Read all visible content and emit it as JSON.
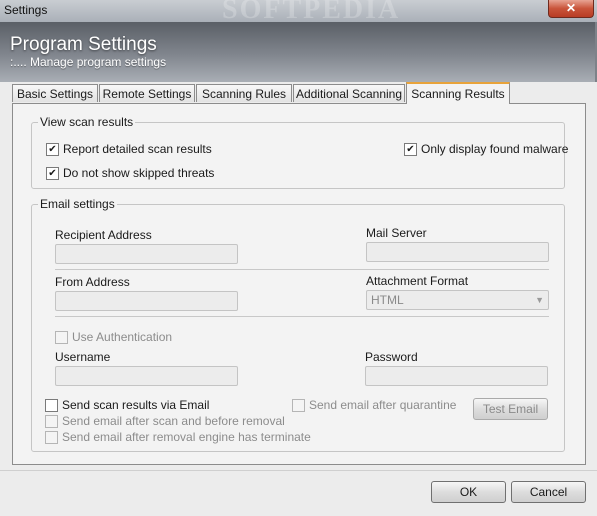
{
  "window": {
    "title": "Settings",
    "close_label": "✕",
    "watermark": "SOFTPEDIA"
  },
  "header": {
    "title": "Program Settings",
    "subtitle": ":.... Manage program settings"
  },
  "tabs": [
    {
      "label": "Basic Settings"
    },
    {
      "label": "Remote Settings"
    },
    {
      "label": "Scanning Rules"
    },
    {
      "label": "Additional Scanning"
    },
    {
      "label": "Scanning Results",
      "active": true
    }
  ],
  "view_scan_results": {
    "legend": "View scan results",
    "report_detailed": {
      "label": "Report detailed scan results",
      "checked": true
    },
    "do_not_show_skipped": {
      "label": "Do not show skipped threats",
      "checked": true
    },
    "only_found_malware": {
      "label": "Only display found malware",
      "checked": true
    }
  },
  "email_settings": {
    "legend": "Email settings",
    "recipient_label": "Recipient Address",
    "recipient_value": "",
    "mail_server_label": "Mail Server",
    "mail_server_value": "",
    "from_label": "From Address",
    "from_value": "",
    "attachment_label": "Attachment Format",
    "attachment_value": "HTML",
    "use_auth": {
      "label": "Use Authentication",
      "checked": false
    },
    "username_label": "Username",
    "username_value": "",
    "password_label": "Password",
    "password_value": "",
    "send_scan_results": {
      "label": "Send scan results via Email",
      "checked": false
    },
    "send_after_quarantine": {
      "label": "Send email after quarantine",
      "checked": false
    },
    "send_before_removal": {
      "label": "Send email after scan and before removal",
      "checked": false
    },
    "send_after_removal": {
      "label": "Send email after removal engine has terminate",
      "checked": false
    },
    "test_email_label": "Test Email"
  },
  "footer": {
    "ok_label": "OK",
    "cancel_label": "Cancel"
  }
}
